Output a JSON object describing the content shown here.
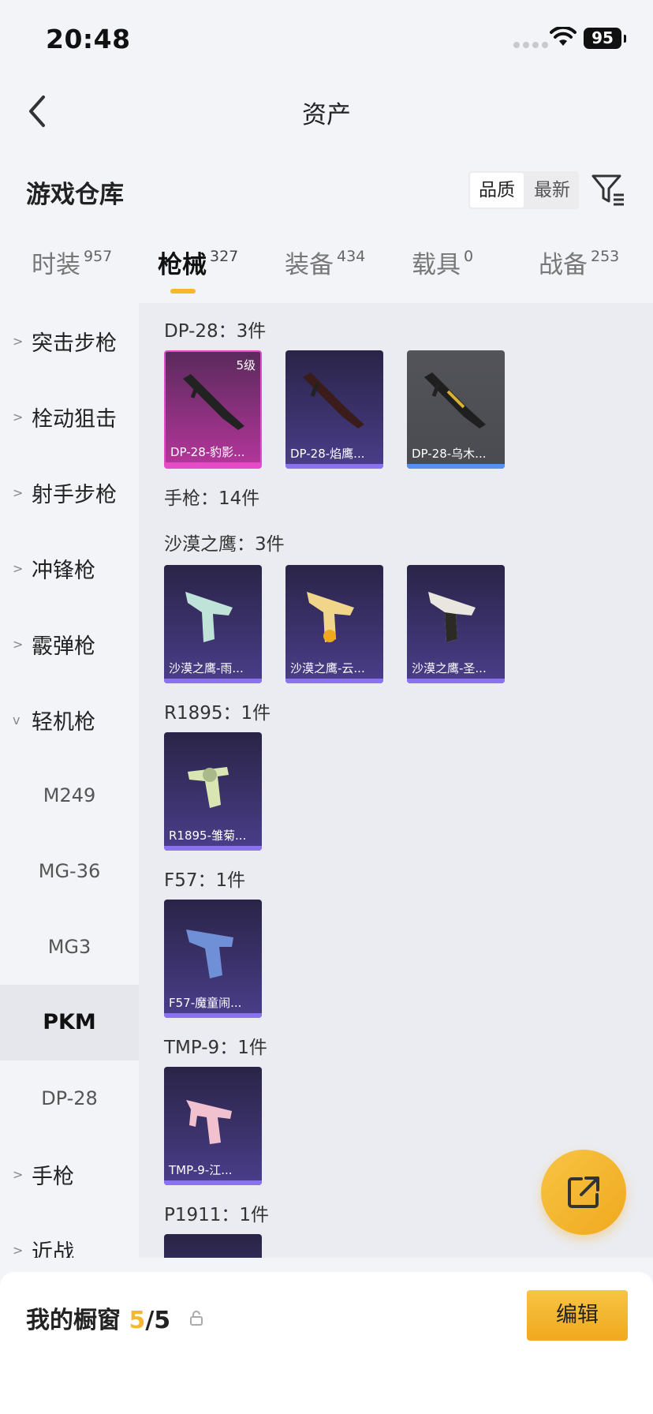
{
  "status_bar": {
    "time": "20:48",
    "battery": "95"
  },
  "nav": {
    "title": "资产"
  },
  "section": {
    "title": "游戏仓库",
    "sort_quality": "品质",
    "sort_newest": "最新"
  },
  "tabs": [
    {
      "label": "时装",
      "count": "957"
    },
    {
      "label": "枪械",
      "count": "327"
    },
    {
      "label": "装备",
      "count": "434"
    },
    {
      "label": "载具",
      "count": "0"
    },
    {
      "label": "战备",
      "count": "253"
    }
  ],
  "sidebar": {
    "categories": [
      {
        "label": "突击步枪"
      },
      {
        "label": "栓动狙击"
      },
      {
        "label": "射手步枪"
      },
      {
        "label": "冲锋枪"
      },
      {
        "label": "霰弹枪"
      },
      {
        "label": "轻机枪"
      },
      {
        "label": "手枪"
      },
      {
        "label": "近战"
      }
    ],
    "subitems": [
      {
        "label": "M249"
      },
      {
        "label": "MG-36"
      },
      {
        "label": "MG3"
      },
      {
        "label": "PKM"
      },
      {
        "label": "DP-28"
      }
    ]
  },
  "groups": [
    {
      "label": "DP-28：3件",
      "items": [
        {
          "name": "DP-28-豹影...",
          "badge": "5级",
          "rarity": "gold"
        },
        {
          "name": "DP-28-焰鹰...",
          "rarity": "purple"
        },
        {
          "name": "DP-28-乌木...",
          "rarity": "grey"
        }
      ]
    },
    {
      "label": "手枪：14件"
    },
    {
      "label": "沙漠之鹰：3件",
      "items": [
        {
          "name": "沙漠之鹰-雨...",
          "rarity": "purple"
        },
        {
          "name": "沙漠之鹰-云...",
          "rarity": "purple"
        },
        {
          "name": "沙漠之鹰-圣...",
          "rarity": "purple"
        }
      ]
    },
    {
      "label": "R1895：1件",
      "items": [
        {
          "name": "R1895-雏菊...",
          "rarity": "purple"
        }
      ]
    },
    {
      "label": "F57：1件",
      "items": [
        {
          "name": "F57-魔童闹...",
          "rarity": "purple"
        }
      ]
    },
    {
      "label": "TMP-9：1件",
      "items": [
        {
          "name": "TMP-9-江...",
          "rarity": "purple"
        }
      ]
    },
    {
      "label": "P1911：1件"
    }
  ],
  "showcase": {
    "label": "我的橱窗",
    "current": "5",
    "separator": "/",
    "total": "5",
    "edit_label": "编辑"
  },
  "colors": {
    "accent": "#f5b72d",
    "purple_rarity": "#8a72f0",
    "gold_rarity": "#e54bc7",
    "grey_rarity_bar": "#5b8ef2"
  }
}
